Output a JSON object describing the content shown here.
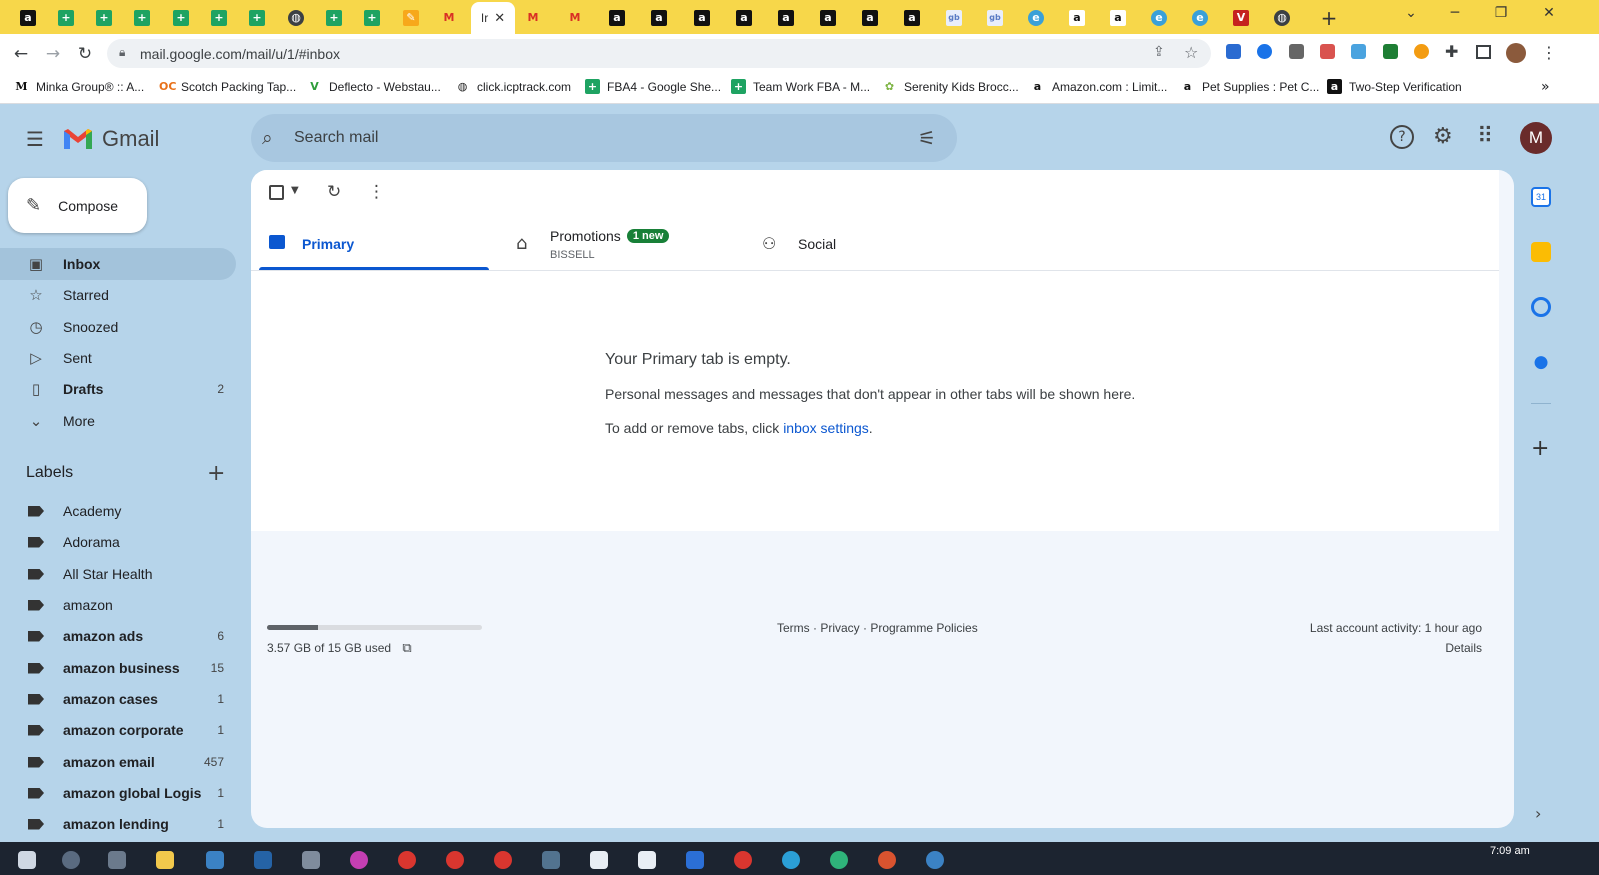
{
  "browser": {
    "active_tab_title": "Ir",
    "url": "mail.google.com/mail/u/1/#inbox",
    "bookmarks": [
      {
        "label": "Minka Group® :: A...",
        "icon": "minka-icon"
      },
      {
        "label": "Scotch Packing Tap...",
        "icon": "oc-icon"
      },
      {
        "label": "Deflecto - Webstau...",
        "icon": "deflecto-icon"
      },
      {
        "label": "click.icptrack.com",
        "icon": "globe-icon"
      },
      {
        "label": "FBA4 - Google She...",
        "icon": "sheets-icon"
      },
      {
        "label": "Team Work FBA - M...",
        "icon": "sheets-icon"
      },
      {
        "label": "Serenity Kids Brocc...",
        "icon": "serenity-icon"
      },
      {
        "label": "Amazon.com : Limit...",
        "icon": "amazon-icon"
      },
      {
        "label": "Pet Supplies : Pet C...",
        "icon": "amazon-icon"
      },
      {
        "label": "Two-Step Verification",
        "icon": "amazon-icon"
      }
    ]
  },
  "gmail": {
    "brand": "Gmail",
    "search_placeholder": "Search mail",
    "avatar_letter": "M",
    "compose_label": "Compose",
    "nav": [
      {
        "label": "Inbox",
        "icon": "inbox-icon",
        "count": "",
        "bold": true,
        "active": true
      },
      {
        "label": "Starred",
        "icon": "star-icon",
        "count": "",
        "bold": false,
        "active": false
      },
      {
        "label": "Snoozed",
        "icon": "clock-icon",
        "count": "",
        "bold": false,
        "active": false
      },
      {
        "label": "Sent",
        "icon": "send-icon",
        "count": "",
        "bold": false,
        "active": false
      },
      {
        "label": "Drafts",
        "icon": "draft-icon",
        "count": "2",
        "bold": true,
        "active": false
      },
      {
        "label": "More",
        "icon": "chevron-down-icon",
        "count": "",
        "bold": false,
        "active": false
      }
    ],
    "labels_heading": "Labels",
    "labels": [
      {
        "label": "Academy",
        "count": "",
        "bold": false
      },
      {
        "label": "Adorama",
        "count": "",
        "bold": false
      },
      {
        "label": "All Star Health",
        "count": "",
        "bold": false
      },
      {
        "label": "amazon",
        "count": "",
        "bold": false
      },
      {
        "label": "amazon ads",
        "count": "6",
        "bold": true
      },
      {
        "label": "amazon business",
        "count": "15",
        "bold": true
      },
      {
        "label": "amazon cases",
        "count": "1",
        "bold": true
      },
      {
        "label": "amazon corporate",
        "count": "1",
        "bold": true
      },
      {
        "label": "amazon email",
        "count": "457",
        "bold": true
      },
      {
        "label": "amazon global Logis",
        "count": "1",
        "bold": true
      },
      {
        "label": "amazon lending",
        "count": "1",
        "bold": true
      }
    ],
    "tabs": {
      "primary": "Primary",
      "promotions": "Promotions",
      "promotions_badge": "1 new",
      "promotions_sub": "BISSELL",
      "social": "Social"
    },
    "empty": {
      "title": "Your Primary tab is empty.",
      "line1": "Personal messages and messages that don't appear in other tabs will be shown here.",
      "line2_prefix": "To add or remove tabs, click ",
      "line2_link": "inbox settings",
      "line2_suffix": "."
    },
    "footer": {
      "storage_text": "3.57 GB of 15 GB used",
      "storage_fraction": 0.238,
      "links": "Terms · Privacy · Programme Policies",
      "last_activity": "Last account activity: 1 hour ago",
      "details": "Details"
    }
  },
  "taskbar": {
    "clock": "7:09 am"
  },
  "colors": {
    "tabstrip": "#f7d74a",
    "gmail_bg": "#b6d4ea",
    "primary_blue": "#0b57d0",
    "badge_green": "#188038"
  }
}
